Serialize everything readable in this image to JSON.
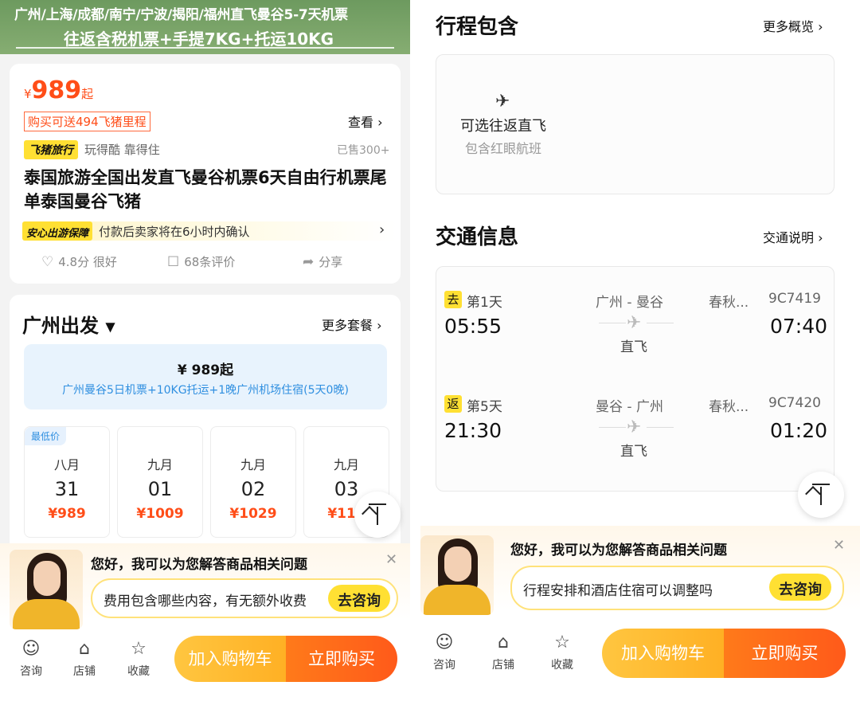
{
  "left": {
    "banner": {
      "line1": "广州/上海/成都/南宁/宁波/揭阳/福州直飞曼谷5-7天机票",
      "line2": "往返含税机票+手提7KG+托运10KG"
    },
    "price": {
      "currency": "¥",
      "value": "989",
      "suffix": "起"
    },
    "mileage": "购买可送494飞猪里程",
    "view_link": "查看 ›",
    "brand": {
      "tag": "飞猪旅行",
      "desc": "玩得酷 靠得住",
      "sold": "已售300+"
    },
    "title": "泰国旅游全国出发直飞曼谷机票6天自由行机票尾单泰国曼谷飞猪",
    "guarantee": {
      "tag": "安心出游保障",
      "text": "付款后卖家将在6小时内确认",
      "arrow": "›"
    },
    "stats": {
      "score": "4.8分 很好",
      "reviews": "68条评价",
      "share": "分享"
    },
    "depart": {
      "title": "广州出发",
      "more": "更多套餐 ›"
    },
    "package": {
      "price": "¥ 989起",
      "desc": "广州曼谷5日机票+10KG托运+1晚广州机场住宿(5天0晚)"
    },
    "dates": [
      {
        "badge": "最低价",
        "month": "八月",
        "day": "31",
        "price": "¥989"
      },
      {
        "badge": "",
        "month": "九月",
        "day": "01",
        "price": "¥1009"
      },
      {
        "badge": "",
        "month": "九月",
        "day": "02",
        "price": "¥1029"
      },
      {
        "badge": "",
        "month": "九月",
        "day": "03",
        "price": "¥110"
      }
    ],
    "assistant": {
      "greeting": "您好，我可以为您解答商品相关问题",
      "question": "费用包含哪些内容，有无额外收费",
      "button": "去咨询"
    }
  },
  "right": {
    "include": {
      "title": "行程包含",
      "more": "更多概览 ›",
      "line1": "可选往返直飞",
      "line2": "包含红眼航班"
    },
    "transport": {
      "title": "交通信息",
      "more": "交通说明 ›"
    },
    "flights": [
      {
        "tag": "去",
        "day": "第1天",
        "route": "广州 - 曼谷",
        "airline": "春秋...",
        "number": "9C7419",
        "dep": "05:55",
        "arr": "07:40",
        "type": "直飞"
      },
      {
        "tag": "返",
        "day": "第5天",
        "route": "曼谷 - 广州",
        "airline": "春秋...",
        "number": "9C7420",
        "dep": "21:30",
        "arr": "01:20",
        "type": "直飞"
      }
    ],
    "assistant": {
      "greeting": "您好，我可以为您解答商品相关问题",
      "question": "行程安排和酒店住宿可以调整吗",
      "button": "去咨询"
    }
  },
  "nav": {
    "consult": "咨询",
    "shop": "店铺",
    "favorite": "收藏",
    "cart": "加入购物车",
    "buy": "立即购买"
  },
  "colors": {
    "price": "#ff4d18",
    "accent_yellow": "#ffe033",
    "buy_orange": "#ff5a1a",
    "cart_yellow": "#ffb024",
    "link_blue": "#2f8fe0"
  }
}
